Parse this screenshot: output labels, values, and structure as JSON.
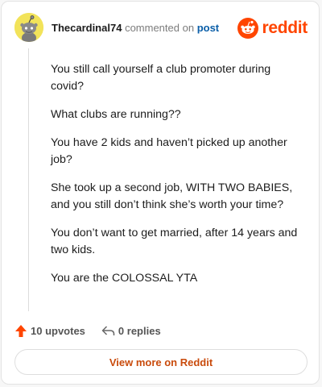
{
  "header": {
    "username": "Thecardinal74",
    "commented_on": "commented on",
    "post_link": "post",
    "brand": "reddit"
  },
  "comment": {
    "paragraphs": [
      "You still call yourself a club promoter during covid?",
      "What clubs are running??",
      "You have 2 kids and haven’t picked up another job?",
      "She took up a second job, WITH TWO BABIES, and you still don’t think she’s worth your time?",
      "You don’t want to get married, after 14 years and two kids.",
      "You are the COLOSSAL YTA"
    ]
  },
  "actions": {
    "upvotes": "10 upvotes",
    "replies": "0 replies"
  },
  "footer": {
    "view_more": "View more on Reddit"
  },
  "colors": {
    "brand": "#ff4500",
    "link": "#0a5ea8",
    "avatar_bg": "#f2e35a"
  },
  "icons": {
    "avatar": "snoo-avatar-icon",
    "logo": "reddit-logo-icon",
    "upvote": "upvote-arrow-icon",
    "reply": "reply-arrow-icon"
  }
}
